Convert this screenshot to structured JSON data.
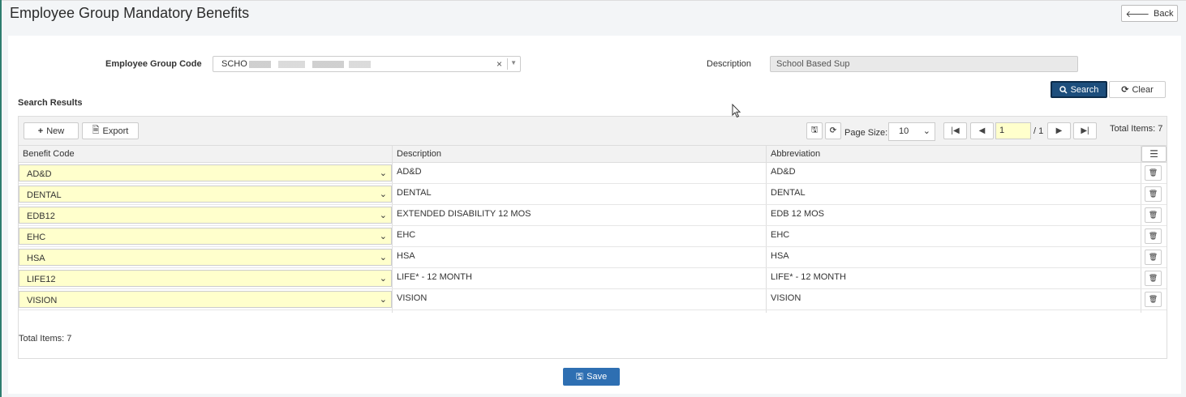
{
  "page": {
    "title": "Employee Group Mandatory Benefits",
    "back_label": "Back"
  },
  "filters": {
    "group_code_label": "Employee Group Code",
    "group_code_value": "SCHO",
    "description_label": "Description",
    "description_value": "School Based Sup"
  },
  "actions": {
    "search_label": "Search",
    "clear_label": "Clear"
  },
  "results": {
    "heading": "Search Results",
    "new_label": "New",
    "export_label": "Export",
    "page_size_label": "Page Size:",
    "page_size_value": "10",
    "current_page": "1",
    "page_total": "/ 1",
    "total_items_top": "Total Items: 7",
    "total_items_bottom": "Total Items: 7",
    "columns": [
      "Benefit Code",
      "Description",
      "Abbreviation"
    ],
    "rows": [
      {
        "code": "AD&D",
        "description": "AD&D",
        "abbreviation": "AD&D"
      },
      {
        "code": "DENTAL",
        "description": "DENTAL",
        "abbreviation": "DENTAL"
      },
      {
        "code": "EDB12",
        "description": "EXTENDED DISABILITY 12 MOS",
        "abbreviation": "EDB 12 MOS"
      },
      {
        "code": "EHC",
        "description": "EHC",
        "abbreviation": "EHC"
      },
      {
        "code": "HSA",
        "description": "HSA",
        "abbreviation": "HSA"
      },
      {
        "code": "LIFE12",
        "description": "LIFE* - 12 MONTH",
        "abbreviation": "LIFE* - 12 MONTH"
      },
      {
        "code": "VISION",
        "description": "VISION",
        "abbreviation": "VISION"
      }
    ]
  },
  "footer": {
    "save_label": "Save"
  },
  "colors": {
    "primary": "#1d4e7c",
    "save": "#2e6fb2",
    "input_highlight": "#ffffcc",
    "accent": "#2e7d6f"
  }
}
